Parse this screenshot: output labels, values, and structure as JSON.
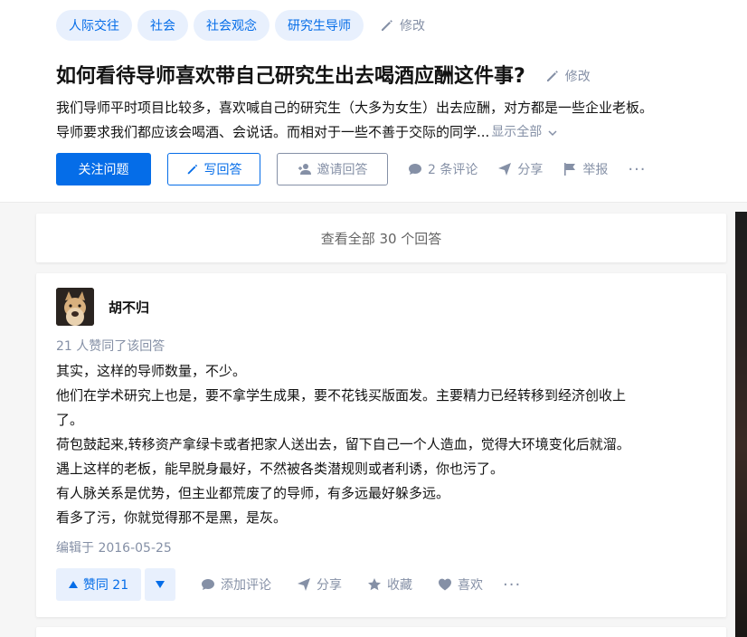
{
  "question": {
    "topics": [
      "人际交往",
      "社会",
      "社会观念",
      "研究生导师"
    ],
    "edit_topics_label": "修改",
    "title": "如何看待导师喜欢带自己研究生出去喝酒应酬这件事?",
    "edit_title_label": "修改",
    "detail_line1": "我们导师平时项目比较多，喜欢喊自己的研究生（大多为女生）出去应酬，对方都是一些企业老板。",
    "detail_line2": "导师要求我们都应该会喝酒、会说话。而相对于一些不善于交际的同学...",
    "show_all_label": "显示全部",
    "actions": {
      "follow": "关注问题",
      "write": "写回答",
      "invite": "邀请回答",
      "comments": "2 条评论",
      "share": "分享",
      "report": "举报",
      "more": "···"
    }
  },
  "view_all_answers": "查看全部 30 个回答",
  "answer": {
    "author": "胡不归",
    "votes_info": "21 人赞同了该回答",
    "paragraphs": [
      "其实，这样的导师数量，不少。",
      "他们在学术研究上也是，要不拿学生成果，要不花钱买版面发。主要精力已经转移到经济创收上",
      "了。",
      "荷包鼓起来,转移资产拿绿卡或者把家人送出去，留下自己一个人造血，觉得大环境变化后就溜。",
      "遇上这样的老板，能早脱身最好，不然被各类潜规则或者利诱，你也污了。",
      "有人脉关系是优势，但主业都荒废了的导师，有多远最好躲多远。",
      "看多了污，你就觉得那不是黑，是灰。"
    ],
    "edited": "编辑于 2016-05-25",
    "actions": {
      "upvote": "赞同 21",
      "comment": "添加评论",
      "share": "分享",
      "collect": "收藏",
      "like": "喜欢",
      "more": "···"
    }
  },
  "colors": {
    "brand_blue": "#056de8",
    "tag_bg": "#e8f0fd",
    "muted": "#8590a6",
    "page_bg": "#f6f6f6"
  },
  "icons": [
    "pencil-icon",
    "comment-icon",
    "share-icon",
    "flag-icon",
    "invite-user-icon",
    "chevron-down-icon",
    "triangle-up-icon",
    "triangle-down-icon",
    "star-icon",
    "heart-icon"
  ]
}
